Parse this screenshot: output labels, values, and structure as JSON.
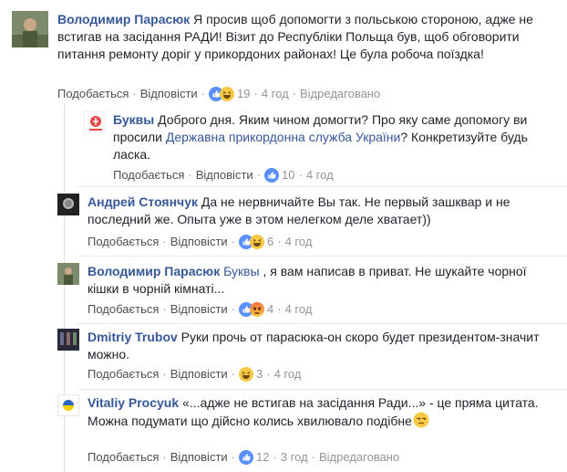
{
  "comments": [
    {
      "author": "Володимир Парасюк",
      "text": " Я просив щоб допомогти з польською стороною, адже не встигав на засідання РАДИ! Візит до Республіки Польща був, щоб обговорити питання ремонту доріг у прикордоних районах! Це була робоча поїздка!",
      "like": "Подобається",
      "reply": "Відповісти",
      "reactions": [
        "like-icon",
        "haha-icon"
      ],
      "count": "19",
      "time": "4 год",
      "edited": "Відредаговано"
    },
    {
      "author": "Буквы",
      "text_a": " Доброго дня. Яким чином домогти? Про яку саме допомогу ви просили ",
      "mention": "Державна прикордонна служба України",
      "text_b": "? Конкретизуйте будь ласка.",
      "like": "Подобається",
      "reply": "Відповісти",
      "reactions": [
        "like-icon"
      ],
      "count": "10",
      "time": "4 год"
    },
    {
      "author": "Андрей Стоянчук",
      "text": " Да не нервничайте Вы так. Не первый зашквар и не последний же. Опыта уже в этом нелегком деле хватает))",
      "like": "Подобається",
      "reply": "Відповісти",
      "reactions": [
        "like-icon",
        "haha-icon"
      ],
      "count": "6",
      "time": "4 год"
    },
    {
      "author": "Володимир Парасюк",
      "mention": "Буквы",
      "text": " , я вам написав в приват. Не шукайте чорної кішки в чорній кімнаті...",
      "like": "Подобається",
      "reply": "Відповісти",
      "reactions": [
        "like-icon",
        "angry-icon"
      ],
      "count": "4",
      "time": "4 год"
    },
    {
      "author": "Dmitriy Trubov",
      "text": " Руки прочь от парасюка-он скоро будет президентом-значит можно.",
      "like": "Подобається",
      "reply": "Відповісти",
      "reactions": [
        "haha-icon"
      ],
      "count": "3",
      "time": "4 год"
    },
    {
      "author": "Vitaliy Procyuk",
      "text_a": " «...адже не встигав на засідання Ради...» - це пряма цитата.",
      "text_b": "Можна подумати що дійсно колись хвилювало подібне",
      "emoji": "unamused-emoji",
      "like": "Подобається",
      "reply": "Відповісти",
      "reactions": [
        "like-icon"
      ],
      "count": "12",
      "time": "3 год",
      "edited": "Відредаговано"
    }
  ],
  "colors": {
    "link": "#365899",
    "like_blue": "#5890ff",
    "haha_yellow": "#f7c844",
    "angry_orange": "#f0703c",
    "muted": "#90949c"
  }
}
